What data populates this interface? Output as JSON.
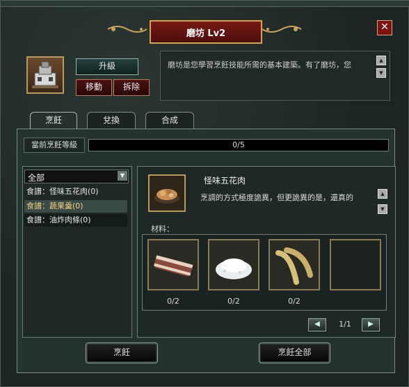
{
  "window": {
    "title": "磨坊 Lv2",
    "close_label": "✕"
  },
  "building": {
    "upgrade_label": "升級",
    "move_label": "移動",
    "demolish_label": "拆除",
    "description": "磨坊是您學習烹飪技能所需的基本建築。有了磨坊，您"
  },
  "tabs": [
    {
      "label": "烹飪",
      "active": true
    },
    {
      "label": "兌換",
      "active": false
    },
    {
      "label": "合成",
      "active": false
    }
  ],
  "level": {
    "label": "當前烹飪等級",
    "progress_text": "0/5",
    "progress_fraction": 0.0
  },
  "recipe_list": {
    "filter": "全部",
    "items": [
      {
        "label": "食譜：怪味五花肉(0)",
        "selected": false
      },
      {
        "label": "食譜：蔬果羹(0)",
        "selected": true
      },
      {
        "label": "食譜：油炸肉條(0)",
        "selected": false
      }
    ]
  },
  "recipe_detail": {
    "name": "怪味五花肉",
    "description": "烹調的方式極度詭異，但更詭異的是，還真的",
    "materials_label": "材料：",
    "materials": [
      {
        "icon": "pork-belly-icon",
        "qty": "0/2"
      },
      {
        "icon": "salt-icon",
        "qty": "0/2"
      },
      {
        "icon": "bean-pods-icon",
        "qty": "0/2"
      },
      {
        "icon": "empty-slot-icon",
        "qty": ""
      }
    ],
    "page": "1/1"
  },
  "actions": {
    "cook_label": "烹飪",
    "cook_all_label": "烹飪全部"
  },
  "colors": {
    "title_plate": "#7a1a17",
    "gold_border": "#c8a45c",
    "selected_text": "#f0d080"
  }
}
